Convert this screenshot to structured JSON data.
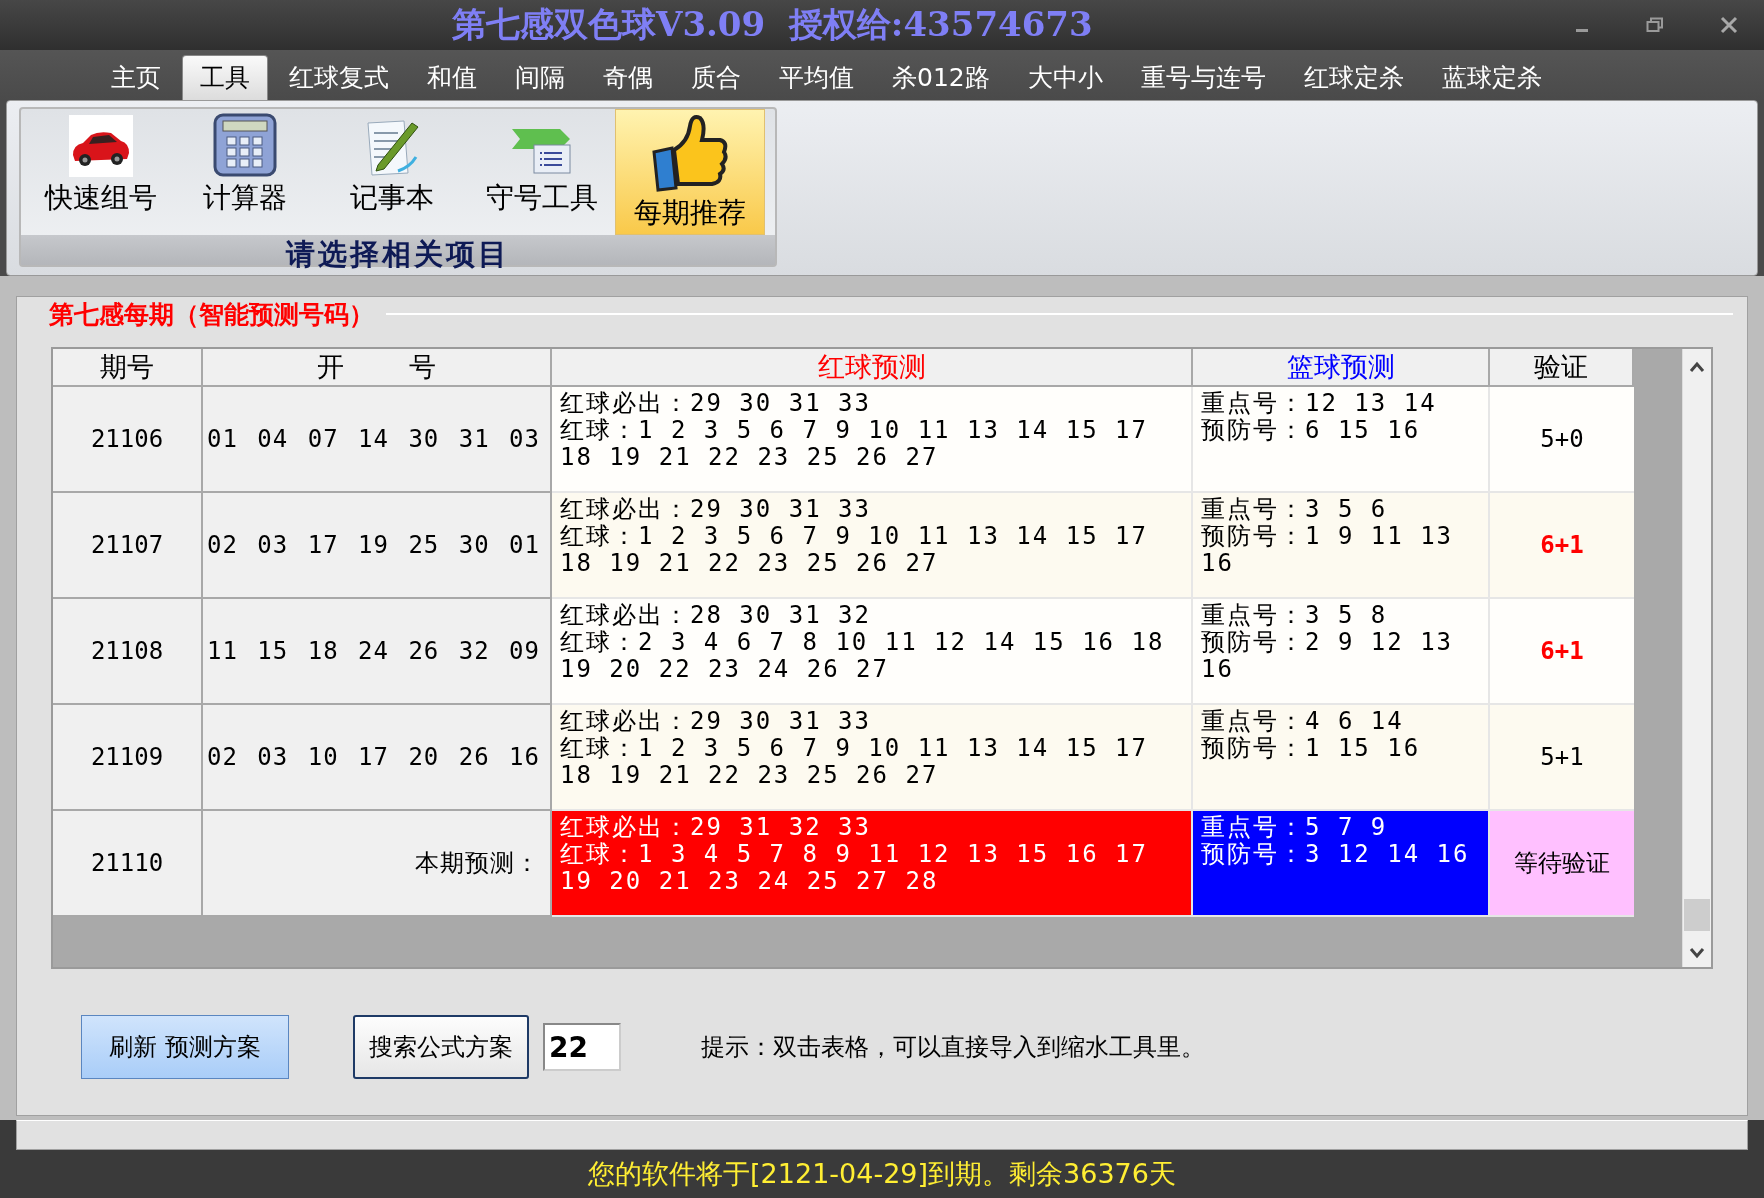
{
  "window": {
    "title": "第七感双色球V3.09  授权给:43574673"
  },
  "menu": [
    {
      "label": "主页",
      "selected": false
    },
    {
      "label": "工具",
      "selected": true
    },
    {
      "label": "红球复式",
      "selected": false
    },
    {
      "label": "和值",
      "selected": false
    },
    {
      "label": "间隔",
      "selected": false
    },
    {
      "label": "奇偶",
      "selected": false
    },
    {
      "label": "质合",
      "selected": false
    },
    {
      "label": "平均值",
      "selected": false
    },
    {
      "label": "杀012路",
      "selected": false
    },
    {
      "label": "大中小",
      "selected": false
    },
    {
      "label": "重号与连号",
      "selected": false
    },
    {
      "label": "红球定杀",
      "selected": false
    },
    {
      "label": "蓝球定杀",
      "selected": false
    }
  ],
  "toolbar": {
    "items": [
      {
        "label": "快速组号",
        "selected": false
      },
      {
        "label": "计算器",
        "selected": false
      },
      {
        "label": "记事本",
        "selected": false
      },
      {
        "label": "守号工具",
        "selected": false
      },
      {
        "label": "每期推荐",
        "selected": true
      }
    ],
    "caption": "请选择相关项目"
  },
  "panel": {
    "title": "第七感每期（智能预测号码）"
  },
  "table": {
    "columns": [
      {
        "label": "期号",
        "color": "#000000"
      },
      {
        "label": "开    号",
        "color": "#000000"
      },
      {
        "label": "红球预测",
        "color": "#ff0000"
      },
      {
        "label": "篮球预测",
        "color": "#0000ff"
      },
      {
        "label": "验证",
        "color": "#000000"
      }
    ],
    "rows": [
      {
        "kind": "history",
        "period": "21106",
        "draw": "01 04 07 14 30 31 03",
        "red_lines": [
          "红球必出：29 30 31 33",
          "红球：1 2 3 5 6 7 9 10 11 13 14 15 17",
          "18 19 21 22 23 25 26 27"
        ],
        "blue_lines": [
          "重点号：12 13 14",
          "预防号：6 15 16"
        ],
        "verify": "5+0",
        "hit": false
      },
      {
        "kind": "history",
        "period": "21107",
        "draw": "02 03 17 19 25 30 01",
        "red_lines": [
          "红球必出：29 30 31 33",
          "红球：1 2 3 5 6 7 9 10 11 13 14 15 17",
          "18 19 21 22 23 25 26 27"
        ],
        "blue_lines": [
          "重点号：3 5 6",
          "预防号：1 9 11 13",
          "16"
        ],
        "verify": "6+1",
        "hit": true
      },
      {
        "kind": "history",
        "period": "21108",
        "draw": "11 15 18 24 26 32 09",
        "red_lines": [
          "红球必出：28 30 31 32",
          "红球：2 3 4 6 7 8 10 11 12 14 15 16 18",
          "19 20 22 23 24 26 27"
        ],
        "blue_lines": [
          "重点号：3 5 8",
          "预防号：2 9 12 13",
          "16"
        ],
        "verify": "6+1",
        "hit": true
      },
      {
        "kind": "history",
        "period": "21109",
        "draw": "02 03 10 17 20 26 16",
        "red_lines": [
          "红球必出：29 30 31 33",
          "红球：1 2 3 5 6 7 9 10 11 13 14 15 17",
          "18 19 21 22 23 25 26 27"
        ],
        "blue_lines": [
          "重点号：4 6 14",
          "预防号：1 15 16"
        ],
        "verify": "5+1",
        "hit": false
      },
      {
        "kind": "prediction",
        "period": "21110",
        "draw": "本期预测：",
        "red_lines": [
          "红球必出：29 31 32 33",
          "红球：1 3 4 5 7 8 9 11 12 13 15 16 17",
          "19 20 21 23 24 25 27 28"
        ],
        "blue_lines": [
          "重点号：5 7 9",
          "预防号：3 12 14 16"
        ],
        "verify": "等待验证",
        "hit": false
      }
    ]
  },
  "actions": {
    "refresh": "刷新 预测方案",
    "search": "搜索公式方案",
    "count": "22",
    "hint": "提示：双击表格，可以直接导入到缩水工具里。"
  },
  "status_bar": "您的软件将于[2121-04-29]到期。剩余36376天"
}
